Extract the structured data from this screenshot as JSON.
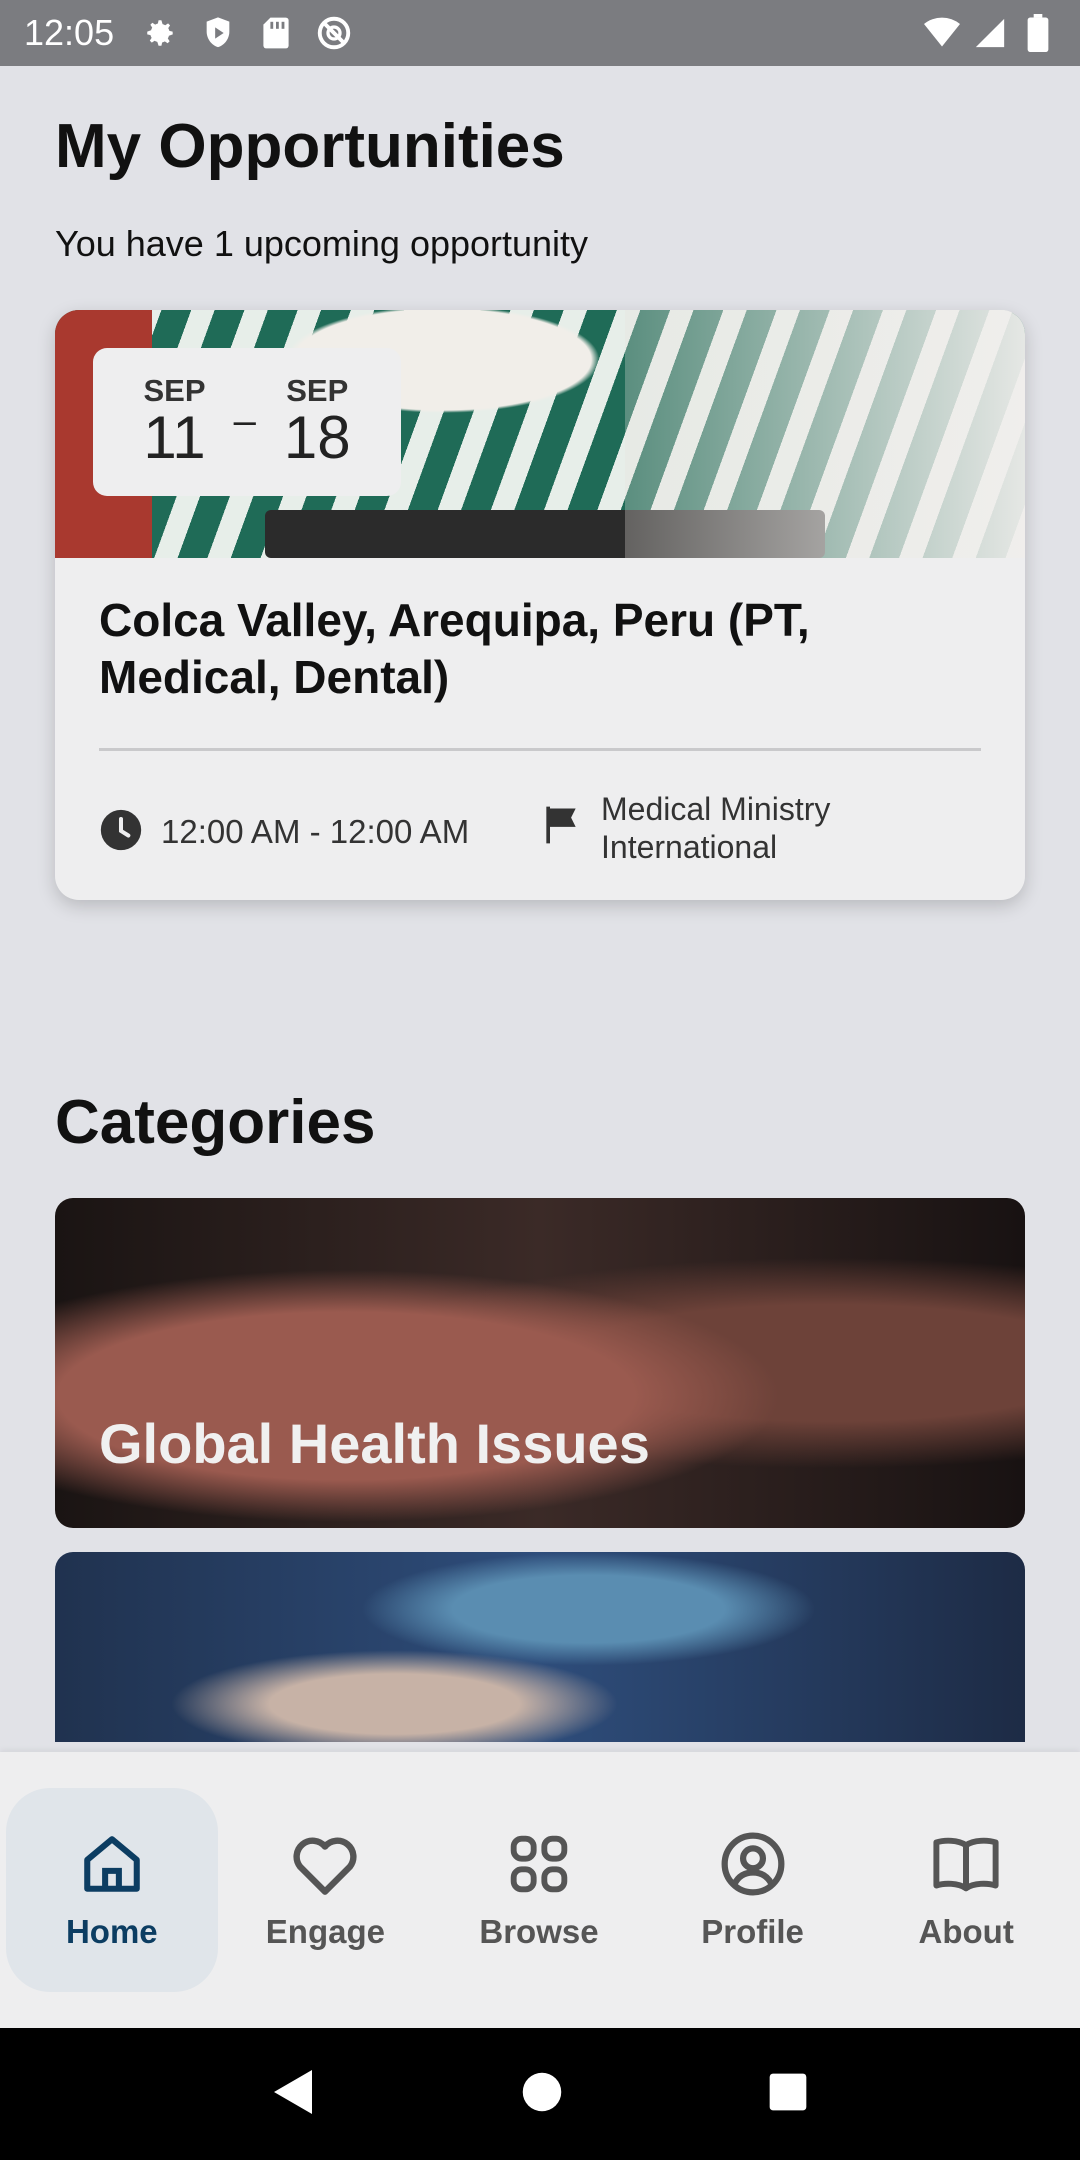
{
  "status_bar": {
    "time": "12:05",
    "left_icons": [
      "gear-icon",
      "shield-icon",
      "sd-card-icon",
      "no-sync-icon"
    ],
    "right_icons": [
      "wifi-icon",
      "signal-icon",
      "battery-icon"
    ]
  },
  "page": {
    "title": "My Opportunities",
    "subtitle": "You have 1 upcoming opportunity"
  },
  "opportunity": {
    "start_month": "SEP",
    "start_day": "11",
    "separator": "–",
    "end_month": "SEP",
    "end_day": "18",
    "title": "Colca Valley, Arequipa, Peru (PT, Medical, Dental)",
    "time": "12:00 AM - 12:00 AM",
    "organization": "Medical Ministry International"
  },
  "categories": {
    "title": "Categories",
    "items": [
      {
        "label": "Global Health Issues"
      },
      {
        "label": ""
      }
    ]
  },
  "bottom_nav": {
    "items": [
      {
        "label": "Home",
        "icon": "home-icon",
        "active": true
      },
      {
        "label": "Engage",
        "icon": "heart-icon",
        "active": false
      },
      {
        "label": "Browse",
        "icon": "grid-icon",
        "active": false
      },
      {
        "label": "Profile",
        "icon": "profile-icon",
        "active": false
      },
      {
        "label": "About",
        "icon": "book-icon",
        "active": false
      }
    ]
  },
  "system_nav": [
    "back-icon",
    "home-circle-icon",
    "recents-icon"
  ],
  "colors": {
    "background": "#e1e2e7",
    "status_bar": "#7b7c80",
    "nav_active": "#0c3d62",
    "nav_active_bg": "#e0e5ea"
  }
}
